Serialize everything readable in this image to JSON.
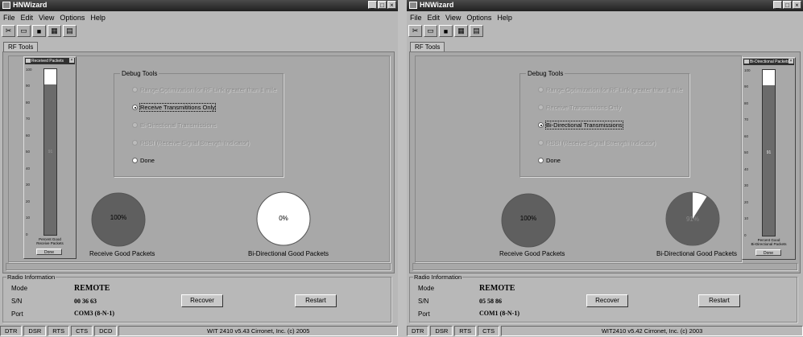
{
  "windows": [
    {
      "title": "HNWizard",
      "menu": [
        "File",
        "Edit",
        "View",
        "Options",
        "Help"
      ],
      "tool_icons": [
        "cut-icon",
        "open-folder-icon",
        "save-disk-icon",
        "grid-icon",
        "paste-icon"
      ],
      "tab": "RF Tools",
      "debug_tools": {
        "legend": "Debug Tools",
        "options": [
          {
            "label": "Range Optimization for RF Link greater than 1 mile",
            "enabled": false,
            "selected": false
          },
          {
            "label": "Receive Transmititions Only",
            "enabled": true,
            "selected": true
          },
          {
            "label": "Bi-Directional Transmissions",
            "enabled": false,
            "selected": false
          },
          {
            "label": "RSSI (Receive Signal Strength Indicator)",
            "enabled": false,
            "selected": false
          },
          {
            "label": "Done",
            "enabled": true,
            "selected": false
          }
        ]
      },
      "packets_window": {
        "title": "Received Packets",
        "ticks": [
          "100",
          "90",
          "80",
          "70",
          "60",
          "50",
          "40",
          "30",
          "20",
          "10",
          "0"
        ],
        "percent_good": 0.91,
        "bar_value_text": "91",
        "caption_lines": [
          "Percent Good",
          "Receive Packets"
        ],
        "done_label": "Done"
      },
      "pies": [
        {
          "label": "Receive Good Packets",
          "value_text": "100%",
          "percent": 100
        },
        {
          "label": "Bi-Directional Good Packets",
          "value_text": "0%",
          "percent": 0
        }
      ],
      "radio_info": {
        "legend": "Radio Information",
        "mode_label": "Mode",
        "mode_value": "REMOTE",
        "sn_label": "S/N",
        "sn_value": "00 36 63",
        "port_label": "Port",
        "port_value": "COM3 (8-N-1)"
      },
      "buttons": {
        "recover": "Recover",
        "restart": "Restart"
      },
      "status": {
        "cells": [
          "DTR",
          "DSR",
          "RTS",
          "CTS",
          "DCD"
        ],
        "copyright": "WIT 2410 v5.43 Cirronet, Inc. (c) 2005"
      }
    },
    {
      "title": "HNWizard",
      "menu": [
        "File",
        "Edit",
        "View",
        "Options",
        "Help"
      ],
      "tool_icons": [
        "cut-icon",
        "open-folder-icon",
        "save-disk-icon",
        "grid-icon",
        "paste-icon"
      ],
      "tab": "RF Tools",
      "debug_tools": {
        "legend": "Debug Tools",
        "options": [
          {
            "label": "Range Optimization for RF Link greater than 1 mile",
            "enabled": false,
            "selected": false
          },
          {
            "label": "Receive Transmititions Only",
            "enabled": false,
            "selected": false
          },
          {
            "label": "Bi-Directional Transmissions",
            "enabled": true,
            "selected": true
          },
          {
            "label": "RSSI (Receive Signal Strength Indicator)",
            "enabled": false,
            "selected": false
          },
          {
            "label": "Done",
            "enabled": true,
            "selected": false
          }
        ]
      },
      "packets_window": {
        "title": "Bi-Directional Packets",
        "ticks": [
          "100",
          "90",
          "80",
          "70",
          "60",
          "50",
          "40",
          "30",
          "20",
          "10",
          "0"
        ],
        "percent_good": 0.91,
        "bar_value_text": "91",
        "caption_lines": [
          "Percent Good",
          "Bi-Directional Packets"
        ],
        "done_label": "Done"
      },
      "pies": [
        {
          "label": "Receive Good Packets",
          "value_text": "100%",
          "percent": 100
        },
        {
          "label": "Bi-Directional Good Packets",
          "value_text": "91%",
          "percent": 91
        }
      ],
      "radio_info": {
        "legend": "Radio Information",
        "mode_label": "Mode",
        "mode_value": "REMOTE",
        "sn_label": "S/N",
        "sn_value": "05 58 86",
        "port_label": "Port",
        "port_value": "COM1 (8-N-1)"
      },
      "buttons": {
        "recover": "Recover",
        "restart": "Restart"
      },
      "status": {
        "cells": [
          "DTR",
          "DSR",
          "RTS",
          "CTS"
        ],
        "copyright": "WIT2410 v5.42 Cirronet, Inc. (c) 2003"
      }
    }
  ],
  "colors": {
    "pie_gray": "#5f5f5f",
    "pie_white": "#ffffff",
    "title_bar": "#2a2a2a"
  }
}
